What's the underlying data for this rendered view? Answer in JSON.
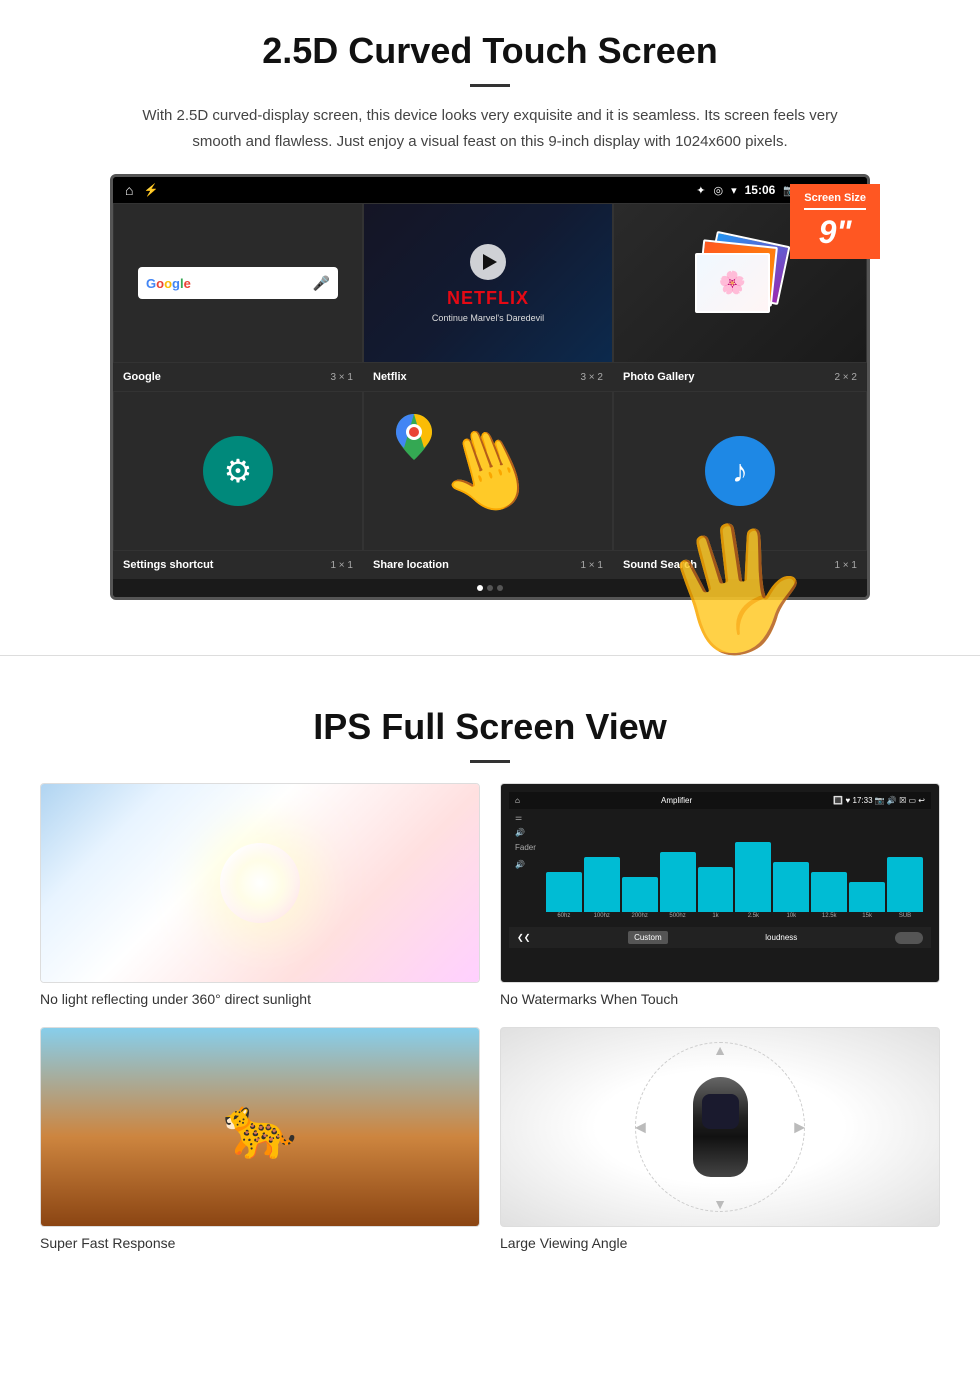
{
  "section1": {
    "title": "2.5D Curved Touch Screen",
    "description": "With 2.5D curved-display screen, this device looks very exquisite and it is seamless. Its screen feels very smooth and flawless. Just enjoy a visual feast on this 9-inch display with 1024x600 pixels.",
    "screen_size_label": "Screen Size",
    "screen_size_number": "9\"",
    "status_bar": {
      "time": "15:06"
    },
    "apps_row1": [
      {
        "name": "Google",
        "size": "3 × 1"
      },
      {
        "name": "Netflix",
        "size": "3 × 2"
      },
      {
        "name": "Photo Gallery",
        "size": "2 × 2"
      }
    ],
    "apps_row2": [
      {
        "name": "Settings shortcut",
        "size": "1 × 1"
      },
      {
        "name": "Share location",
        "size": "1 × 1"
      },
      {
        "name": "Sound Search",
        "size": "1 × 1"
      }
    ],
    "netflix_logo": "NETFLIX",
    "netflix_sub": "Continue Marvel's Daredevil"
  },
  "section2": {
    "title": "IPS Full Screen View",
    "features": [
      {
        "label": "No light reflecting under 360° direct sunlight"
      },
      {
        "label": "No Watermarks When Touch"
      },
      {
        "label": "Super Fast Response"
      },
      {
        "label": "Large Viewing Angle"
      }
    ]
  }
}
